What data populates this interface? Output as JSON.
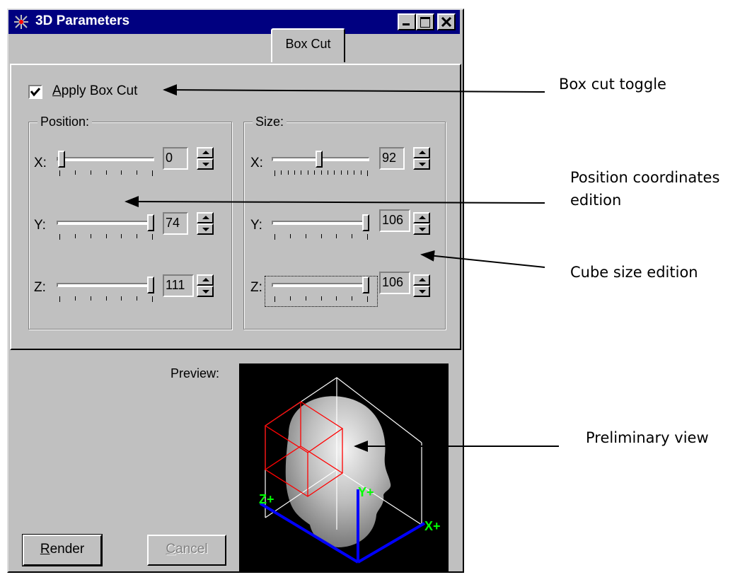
{
  "window": {
    "title": "3D Parameters",
    "controls": [
      "minimize",
      "maximize",
      "close"
    ]
  },
  "tab": {
    "label": "Box Cut"
  },
  "apply_box_cut": {
    "label": "Apply Box Cut",
    "checked": true
  },
  "position": {
    "title": "Position:",
    "x": {
      "label": "X:",
      "value": "0"
    },
    "y": {
      "label": "Y:",
      "value": "74"
    },
    "z": {
      "label": "Z:",
      "value": "111"
    }
  },
  "size": {
    "title": "Size:",
    "x": {
      "label": "X:",
      "value": "92"
    },
    "y": {
      "label": "Y:",
      "value": "106"
    },
    "z": {
      "label": "Z:",
      "value": "106"
    }
  },
  "preview": {
    "label": "Preview:",
    "axes": {
      "z": "Z+",
      "y": "Y+",
      "x": "X+"
    }
  },
  "buttons": {
    "render": "Render",
    "cancel": "Cancel"
  },
  "annotations": {
    "box_cut_toggle": "Box cut toggle",
    "position_line1": "Position coordinates",
    "position_line2": "edition",
    "cube_size": "Cube size edition",
    "preliminary": "Preliminary view"
  },
  "colors": {
    "titlebar": "#000080",
    "face": "#c0c0c0",
    "cut_box": "#ff0000",
    "axis": "#0000ff",
    "axis_label": "#00ff00"
  }
}
